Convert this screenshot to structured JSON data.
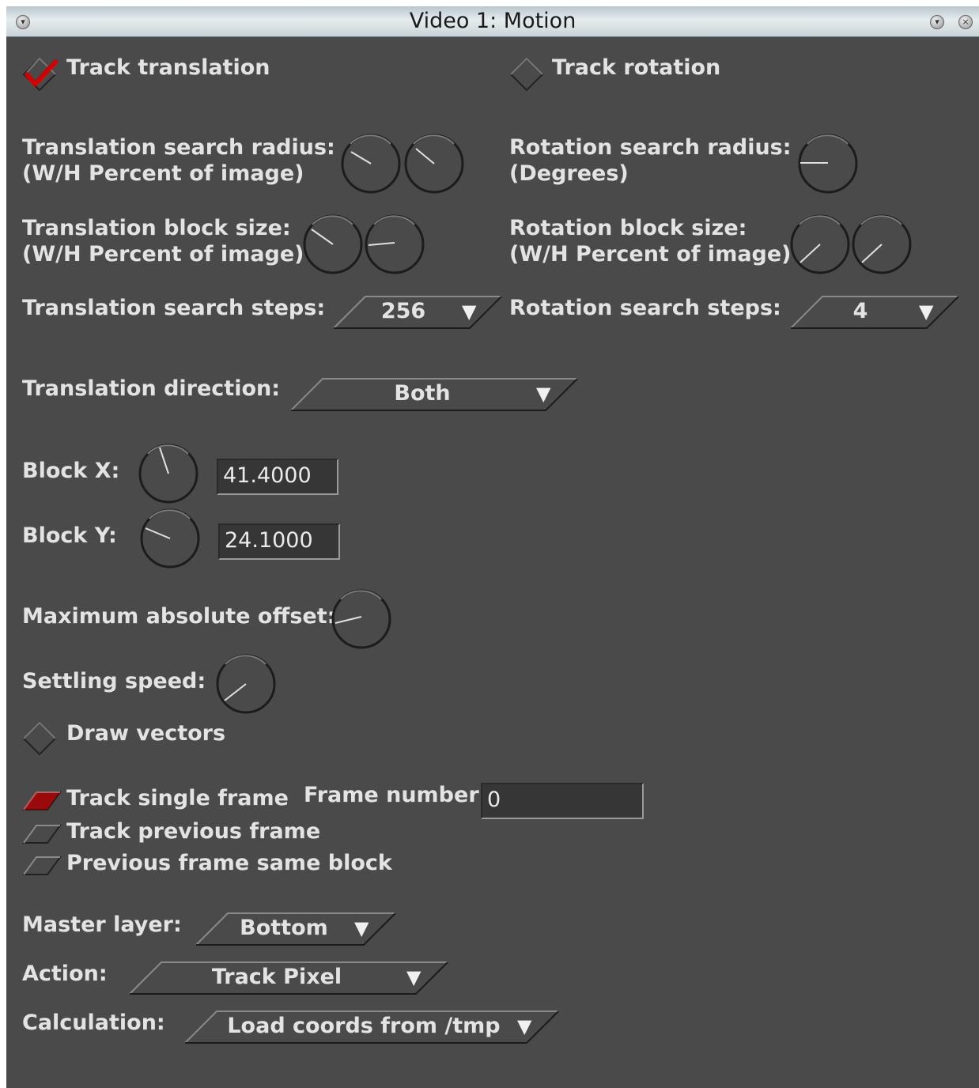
{
  "window": {
    "title": "Video 1: Motion"
  },
  "track_translation": {
    "label": "Track translation",
    "checked": true
  },
  "track_rotation": {
    "label": "Track rotation",
    "checked": false
  },
  "translation_search_radius": {
    "label_line1": "Translation search radius:",
    "label_line2": "(W/H Percent of image)"
  },
  "rotation_search_radius": {
    "label_line1": "Rotation search radius:",
    "label_line2": "(Degrees)"
  },
  "translation_block_size": {
    "label_line1": "Translation block size:",
    "label_line2": "(W/H Percent of image)"
  },
  "rotation_block_size": {
    "label_line1": "Rotation block size:",
    "label_line2": "(W/H Percent of image)"
  },
  "translation_search_steps": {
    "label": "Translation search steps:",
    "value": "256"
  },
  "rotation_search_steps": {
    "label": "Rotation search steps:",
    "value": "4"
  },
  "translation_direction": {
    "label": "Translation direction:",
    "value": "Both"
  },
  "block_x": {
    "label": "Block X:",
    "value": "41.4000"
  },
  "block_y": {
    "label": "Block Y:",
    "value": "24.1000"
  },
  "maximum_absolute_offset": {
    "label": "Maximum absolute offset:"
  },
  "settling_speed": {
    "label": "Settling speed:"
  },
  "draw_vectors": {
    "label": "Draw vectors",
    "checked": false
  },
  "frame_mode": {
    "options": [
      {
        "label": "Track single frame",
        "selected": true
      },
      {
        "label": "Track previous frame",
        "selected": false
      },
      {
        "label": "Previous frame same block",
        "selected": false
      }
    ]
  },
  "frame_number": {
    "label": "Frame number:",
    "value": "0"
  },
  "master_layer": {
    "label": "Master layer:",
    "value": "Bottom"
  },
  "action": {
    "label": "Action:",
    "value": "Track Pixel"
  },
  "calculation": {
    "label": "Calculation:",
    "value": "Load coords from /tmp"
  },
  "icons": {
    "dropdown": "triangle-down-icon",
    "checkmark": "check-icon"
  },
  "colors": {
    "background": "#4a4a4a",
    "text": "#e3e3e3",
    "accent": "#b00000"
  }
}
